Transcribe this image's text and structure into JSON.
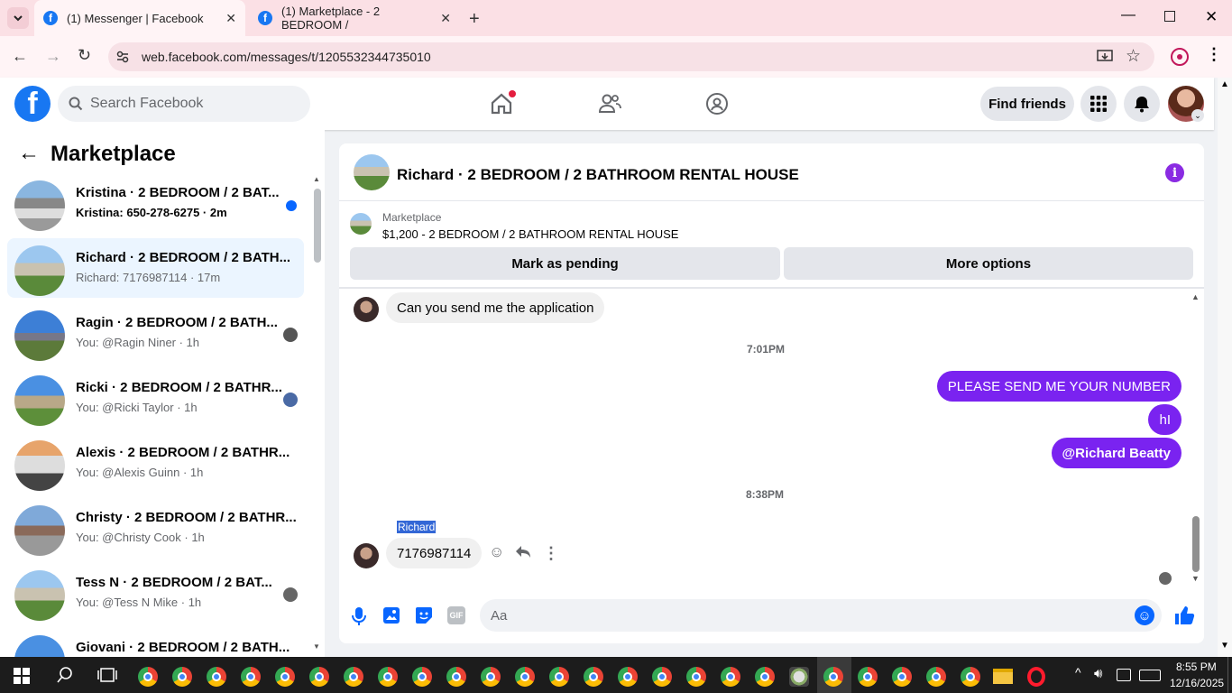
{
  "browser": {
    "tabs": [
      {
        "title": "(1) Messenger | Facebook",
        "active": true
      },
      {
        "title": "(1) Marketplace - 2 BEDROOM /",
        "active": false
      }
    ],
    "url": "web.facebook.com/messages/t/1205532344735010"
  },
  "fb_header": {
    "search_placeholder": "Search Facebook",
    "find_friends": "Find friends"
  },
  "left_panel": {
    "title": "Marketplace",
    "conversations": [
      {
        "title": "Kristina · 2 BEDROOM / 2 BAT...",
        "subtitle": "Kristina: 650-278-6275 · 2m",
        "unread": true
      },
      {
        "title": "Richard · 2 BEDROOM / 2 BATH...",
        "subtitle": "Richard: 7176987114 · 17m",
        "selected": true
      },
      {
        "title": "Ragin · 2 BEDROOM / 2 BATH...",
        "subtitle": "You: @Ragin Niner · 1h"
      },
      {
        "title": "Ricki · 2 BEDROOM / 2 BATHR...",
        "subtitle": "You: @Ricki Taylor · 1h"
      },
      {
        "title": "Alexis · 2 BEDROOM / 2 BATHR...",
        "subtitle": "You: @Alexis Guinn · 1h"
      },
      {
        "title": "Christy · 2 BEDROOM / 2 BATHR...",
        "subtitle": "You: @Christy Cook · 1h"
      },
      {
        "title": "Tess N · 2 BEDROOM / 2 BAT...",
        "subtitle": "You: @Tess N Mike · 1h"
      },
      {
        "title": "Giovani · 2 BEDROOM / 2 BATH...",
        "subtitle": ""
      }
    ]
  },
  "chat": {
    "header_title": "Richard · 2 BEDROOM / 2 BATHROOM RENTAL HOUSE",
    "listing_source": "Marketplace",
    "listing_title": "$1,200 - 2 BEDROOM / 2 BATHROOM RENTAL HOUSE",
    "mark_pending": "Mark as pending",
    "more_options": "More options",
    "messages": {
      "m1": "Can you send me the application",
      "ts1": "7:01PM",
      "m2": "PLEASE SEND ME YOUR NUMBER",
      "m3": "hI",
      "m4": "@Richard Beatty",
      "ts2": "8:38PM",
      "sender": "Richard",
      "m5": "7176987114"
    },
    "composer_placeholder": "Aa"
  },
  "taskbar": {
    "time": "8:55 PM",
    "date": "12/16/2025"
  },
  "colors": {
    "fb_blue": "#1877f2",
    "outgoing_bubble": "#7a23f0",
    "tab_strip": "#fbe0e5"
  }
}
